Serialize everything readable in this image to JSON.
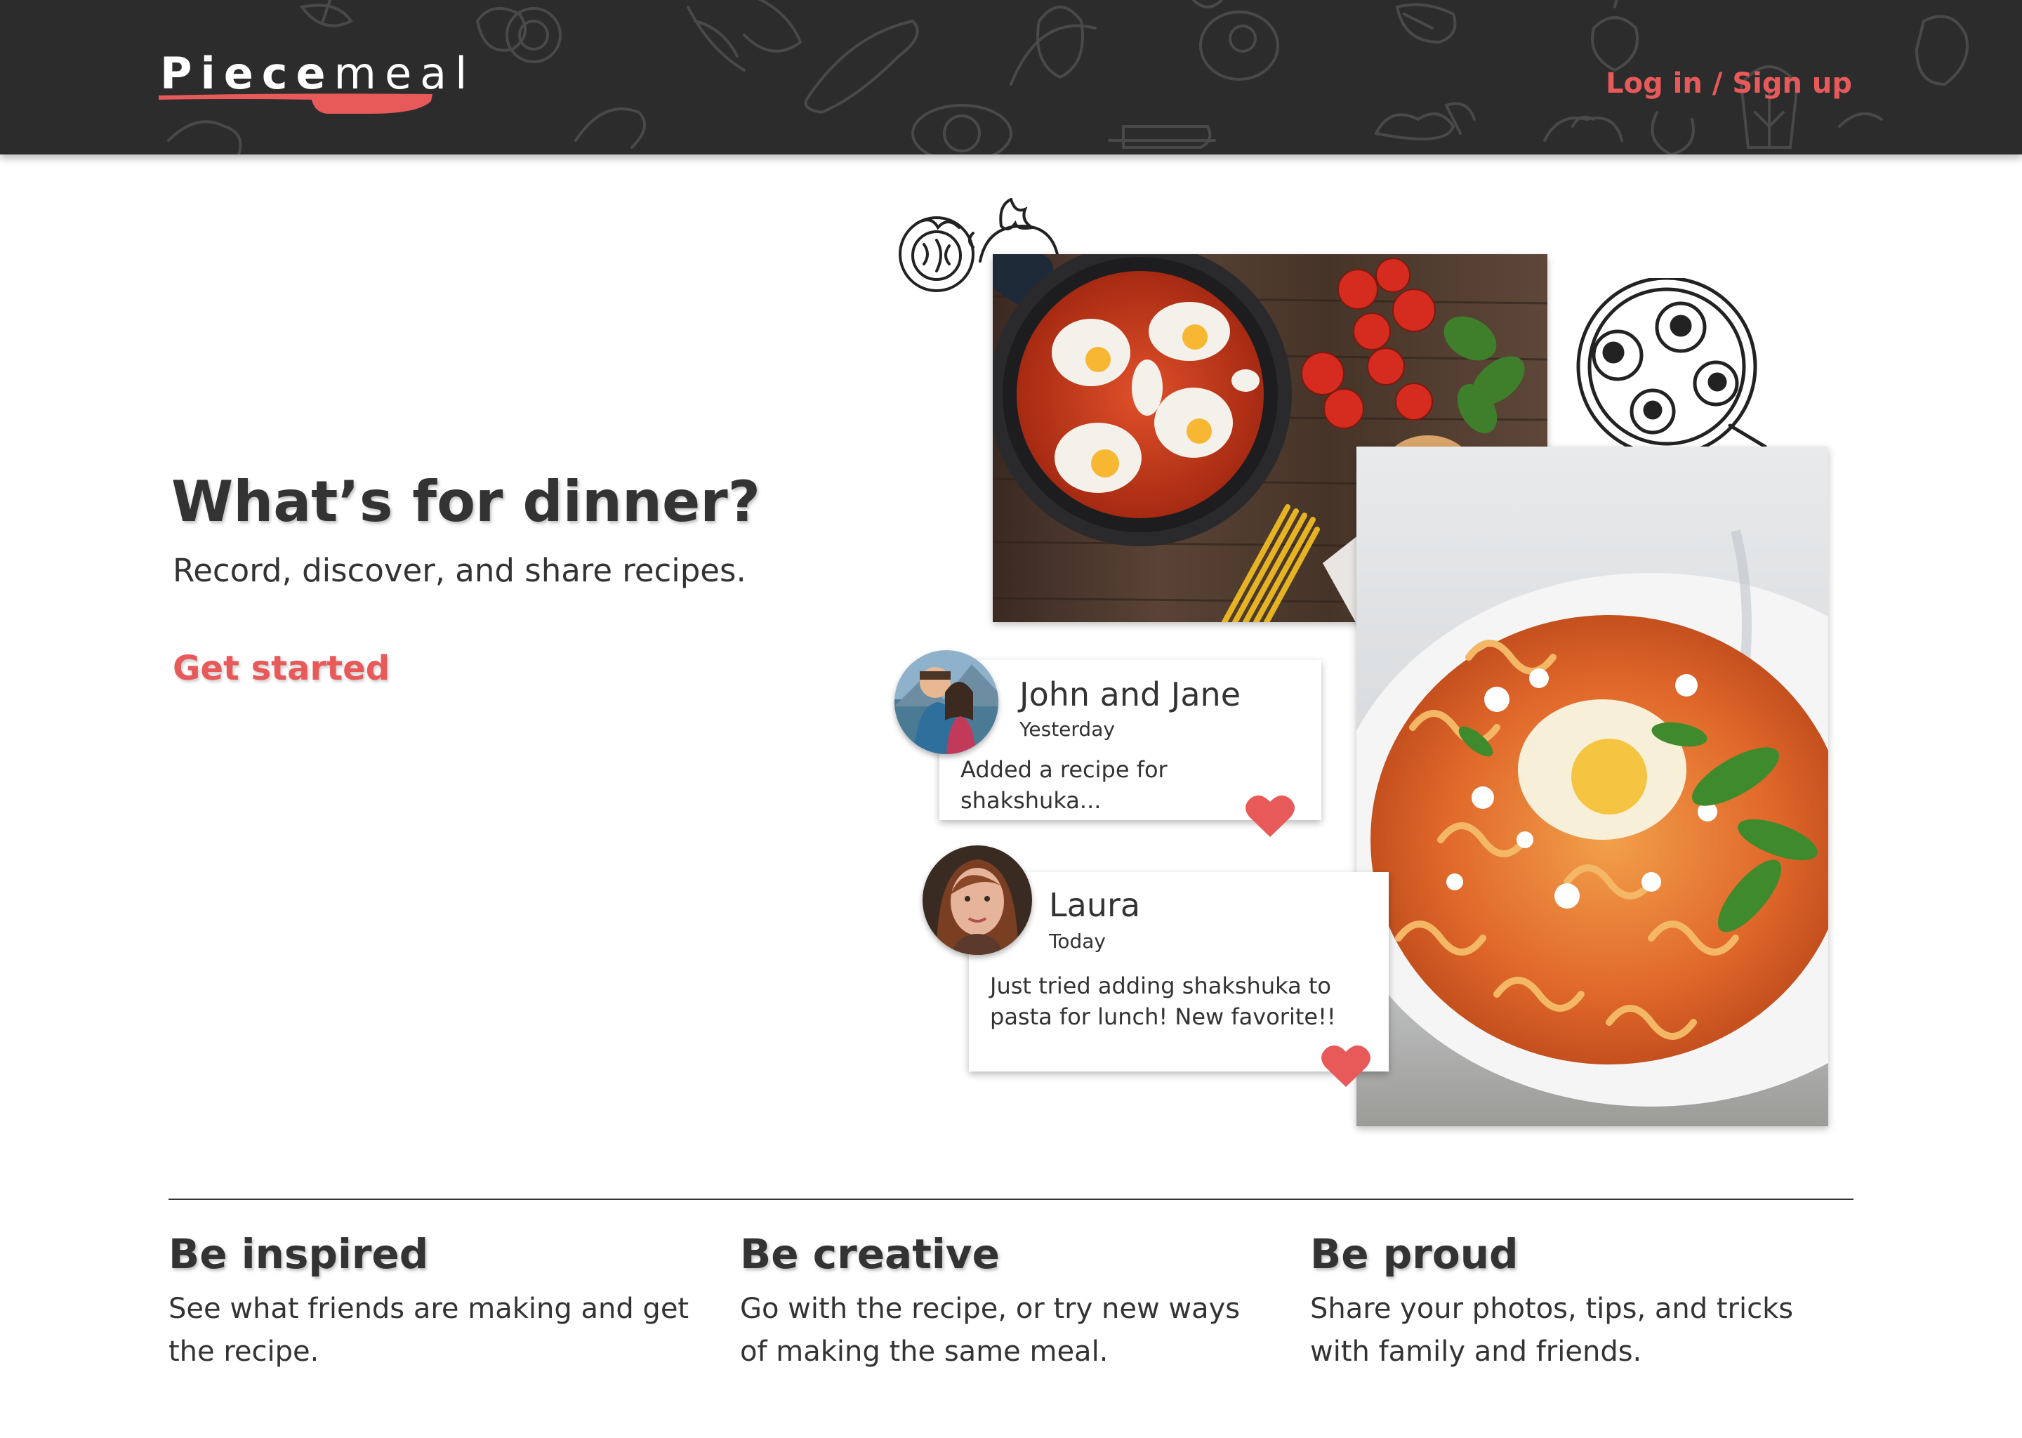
{
  "header": {
    "logo_bold": "Piece",
    "logo_light": "meal",
    "login_label": "Log in / Sign up"
  },
  "hero": {
    "title": "What’s for dinner?",
    "subtitle": "Record, discover, and share recipes.",
    "cta_label": "Get started"
  },
  "feed": [
    {
      "name": "John and Jane",
      "time": "Yesterday",
      "text": "Added a recipe for shakshuka..."
    },
    {
      "name": "Laura",
      "time": "Today",
      "text": "Just tried adding shakshuka to pasta for lunch! New favorite!!"
    }
  ],
  "features": [
    {
      "title": "Be inspired",
      "text": "See what friends are making and get the recipe."
    },
    {
      "title": "Be creative",
      "text": "Go with the recipe, or try new ways of making the same meal."
    },
    {
      "title": "Be proud",
      "text": "Share your photos, tips, and tricks with family and friends."
    }
  ],
  "colors": {
    "accent": "#e85a5a",
    "header_bg": "#2d2c2c",
    "text": "#333333"
  }
}
